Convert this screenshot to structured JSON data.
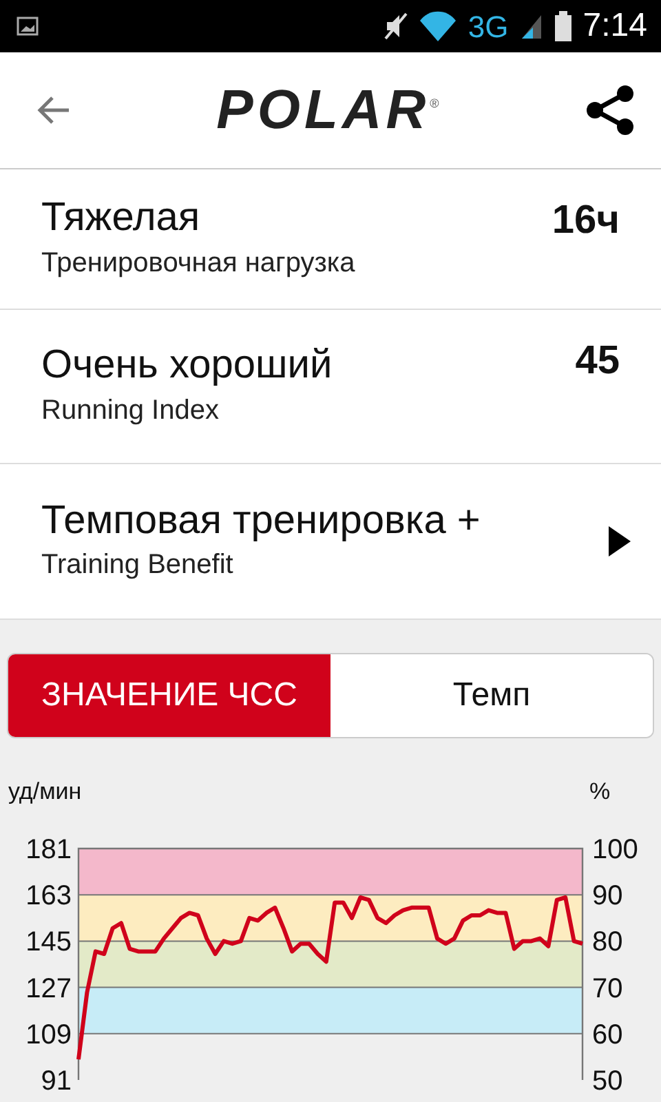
{
  "status_bar": {
    "network": "3G",
    "time": "7:14"
  },
  "header": {
    "logo": "POLAR",
    "logo_mark": "®"
  },
  "summary": [
    {
      "title": "Тяжелая",
      "subtitle": "Тренировочная нагрузка",
      "value": "16ч",
      "kind": "value"
    },
    {
      "title": "Очень хороший",
      "subtitle": "Running Index",
      "value": "45",
      "kind": "value"
    },
    {
      "title": "Темповая тренировка +",
      "subtitle": "Training Benefit",
      "kind": "link"
    }
  ],
  "toggle": [
    {
      "label": "ЗНАЧЕНИЕ ЧСС",
      "selected": true
    },
    {
      "label": "Темп",
      "selected": false
    }
  ],
  "chart": {
    "right_label": "%",
    "right_ticks": [
      "100",
      "90",
      "80",
      "70",
      "60",
      "50"
    ],
    "zones": [
      {
        "color": "#f4b8cb"
      },
      {
        "color": "#fdecc0"
      },
      {
        "color": "#e3eac8"
      },
      {
        "color": "#c7ecf7"
      }
    ],
    "chart_data": {
      "type": "line",
      "ylabel": "уд/мин",
      "ylim": [
        91,
        181
      ],
      "yticks": [
        91,
        109,
        127,
        145,
        163,
        181
      ],
      "grid": true,
      "series": [
        {
          "color": "#d0021b",
          "values": [
            99,
            125,
            141,
            140,
            150,
            152,
            142,
            141,
            141,
            141,
            146,
            150,
            154,
            156,
            155,
            146,
            140,
            145,
            144,
            145,
            154,
            153,
            156,
            158,
            150,
            141,
            144,
            144,
            140,
            137,
            160,
            160,
            154,
            162,
            161,
            154,
            152,
            155,
            157,
            158,
            158,
            158,
            146,
            144,
            146,
            153,
            155,
            155,
            157,
            156,
            156,
            142,
            145,
            145,
            146,
            143,
            161,
            162,
            145,
            144
          ]
        }
      ]
    }
  }
}
